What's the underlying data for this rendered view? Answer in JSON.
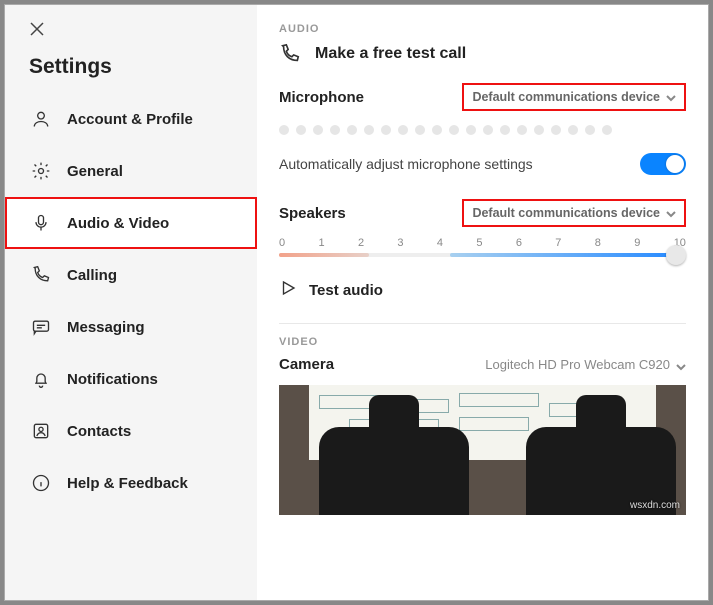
{
  "sidebar": {
    "title": "Settings",
    "items": [
      {
        "label": "Account & Profile"
      },
      {
        "label": "General"
      },
      {
        "label": "Audio & Video"
      },
      {
        "label": "Calling"
      },
      {
        "label": "Messaging"
      },
      {
        "label": "Notifications"
      },
      {
        "label": "Contacts"
      },
      {
        "label": "Help & Feedback"
      }
    ]
  },
  "audio": {
    "section": "AUDIO",
    "test_call": "Make a free test call",
    "mic_label": "Microphone",
    "mic_device": "Default communications device",
    "auto_label": "Automatically adjust microphone settings",
    "speakers_label": "Speakers",
    "speakers_device": "Default communications device",
    "ticks": [
      "0",
      "1",
      "2",
      "3",
      "4",
      "5",
      "6",
      "7",
      "8",
      "9",
      "10"
    ],
    "test_audio": "Test audio"
  },
  "video": {
    "section": "VIDEO",
    "cam_label": "Camera",
    "cam_device": "Logitech HD Pro Webcam C920"
  },
  "watermark": "wsxdn.com"
}
